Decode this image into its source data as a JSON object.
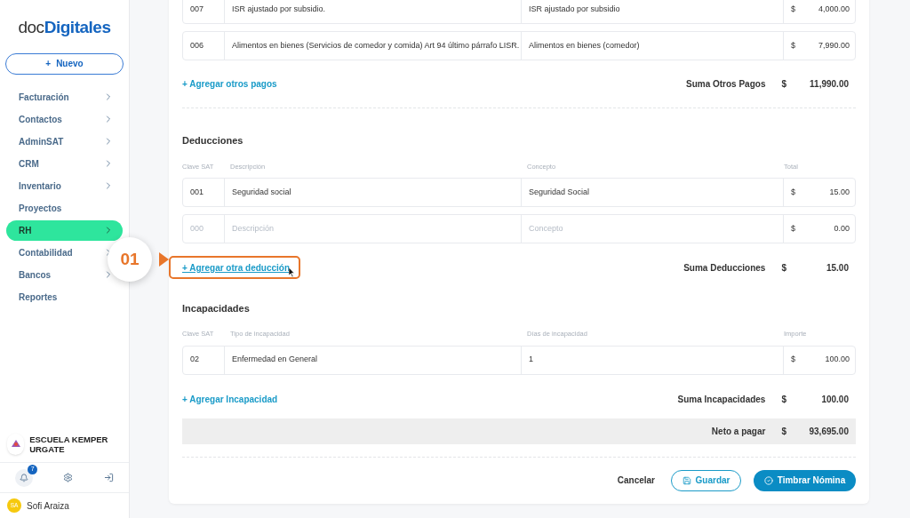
{
  "sidebar": {
    "logo": {
      "light": "doc",
      "bold": "Digitales"
    },
    "new_button": {
      "icon": "+",
      "label": "Nuevo"
    },
    "items": [
      {
        "label": "Facturación",
        "submenu": true,
        "selected": false
      },
      {
        "label": "Contactos",
        "submenu": true,
        "selected": false
      },
      {
        "label": "AdminSAT",
        "submenu": true,
        "selected": false
      },
      {
        "label": "CRM",
        "submenu": true,
        "selected": false
      },
      {
        "label": "Inventario",
        "submenu": true,
        "selected": false
      },
      {
        "label": "Proyectos",
        "submenu": false,
        "selected": false
      },
      {
        "label": "RH",
        "submenu": true,
        "selected": true
      },
      {
        "label": "Contabilidad",
        "submenu": true,
        "selected": false
      },
      {
        "label": "Bancos",
        "submenu": true,
        "selected": false
      },
      {
        "label": "Reportes",
        "submenu": false,
        "selected": false
      }
    ],
    "company": "ESCUELA KEMPER URGATE",
    "notifications": "7",
    "user": {
      "initials": "SA",
      "name": "Sofi Araiza"
    }
  },
  "callout": {
    "label": "01"
  },
  "otros_pagos": {
    "rows": [
      {
        "clave": "007",
        "descripcion": "ISR ajustado por subsidio.",
        "concepto": "ISR ajustado por subsidio",
        "currency": "$",
        "total": "4,000.00"
      },
      {
        "clave": "006",
        "descripcion": "Alimentos en bienes (Servicios de comedor y comida) Art 94 último párrafo LISR.",
        "concepto": "Alimentos en bienes (comedor)",
        "currency": "$",
        "total": "7,990.00"
      }
    ],
    "add_link": {
      "label": "+ Agregar otros pagos",
      "highlighted": false
    },
    "sum": {
      "label": "Suma Otros Pagos",
      "currency": "$",
      "value": "11,990.00"
    }
  },
  "deducciones": {
    "title": "Deducciones",
    "columns": [
      "Clave SAT",
      "Descripción",
      "Concepto",
      "Total"
    ],
    "rows": [
      {
        "clave": "001",
        "descripcion": "Seguridad social",
        "concepto": "Seguridad Social",
        "currency": "$",
        "total": "15.00"
      },
      {
        "clave": {
          "placeholder": "000"
        },
        "descripcion": {
          "placeholder": "Descripción"
        },
        "concepto": {
          "placeholder": "Concepto"
        },
        "currency": "$",
        "total": "0.00"
      }
    ],
    "add_link": {
      "label": "+ Agregar otra deducción",
      "highlighted": true
    },
    "sum": {
      "label": "Suma Deducciones",
      "currency": "$",
      "value": "15.00"
    }
  },
  "incapacidades": {
    "title": "Incapacidades",
    "columns": [
      "Clave SAT",
      "Tipo de incapacidad",
      "Días de incapacidad",
      "Importe"
    ],
    "rows": [
      {
        "clave": "02",
        "descripcion": "Enfermedad en General",
        "concepto": "1",
        "currency": "$",
        "total": "100.00"
      }
    ],
    "add_link": {
      "label": "+ Agregar Incapacidad",
      "highlighted": false
    },
    "sum": {
      "label": "Suma Incapacidades",
      "currency": "$",
      "value": "100.00"
    }
  },
  "neto": {
    "label": "Neto a pagar",
    "currency": "$",
    "value": "93,695.00"
  },
  "actions": {
    "cancel": "Cancelar",
    "save": "Guardar",
    "stamp": "Timbrar Nómina"
  }
}
